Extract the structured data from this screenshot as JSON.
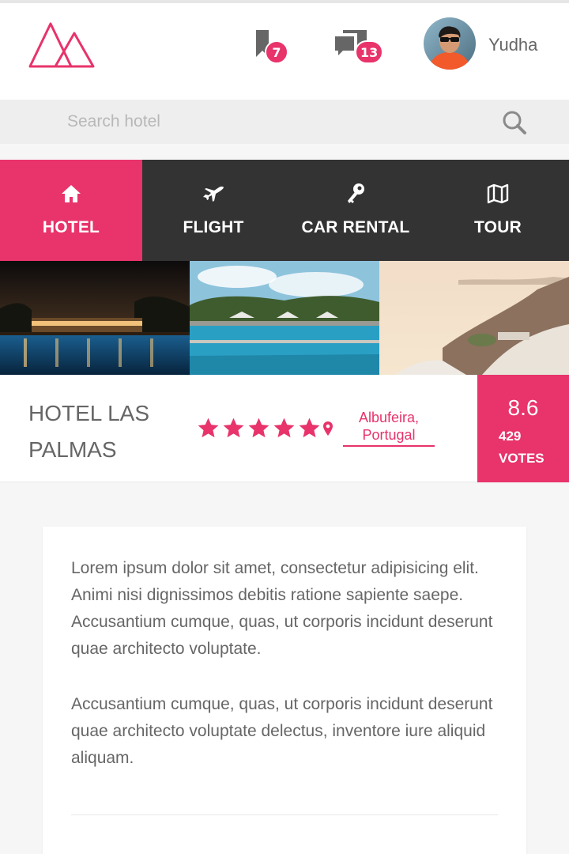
{
  "header": {
    "bookmarks_count": "7",
    "messages_count": "13",
    "user_name": "Yudha"
  },
  "search": {
    "placeholder": "Search hotel",
    "value": ""
  },
  "nav": {
    "items": [
      {
        "label": "HOTEL",
        "icon": "home-icon",
        "active": true
      },
      {
        "label": "FLIGHT",
        "icon": "plane-icon",
        "active": false
      },
      {
        "label": "CAR RENTAL",
        "icon": "key-icon",
        "active": false
      },
      {
        "label": "TOUR",
        "icon": "map-icon",
        "active": false
      }
    ]
  },
  "gallery": [
    "night-pool-photo",
    "resort-pool-photo",
    "seaside-terrace-photo"
  ],
  "hotel": {
    "name": "HOTEL LAS PALMAS",
    "stars": 5,
    "location": "Albufeira, Portugal",
    "rating": "8.6",
    "votes_count": "429",
    "votes_label": "VOTES"
  },
  "description": {
    "paragraphs": [
      "Lorem ipsum dolor sit amet, consectetur adipisicing elit. Animi nisi dignissimos debitis ratione sapiente saepe. Accusantium cumque, quas, ut corporis incidunt deserunt quae architecto voluptate.",
      "Accusantium cumque, quas, ut corporis incidunt deserunt quae architecto voluptate delectus, inventore iure aliquid aliquam."
    ]
  },
  "colors": {
    "accent": "#e8336b",
    "nav_bg": "#333333",
    "search_bg": "#efeeee"
  }
}
